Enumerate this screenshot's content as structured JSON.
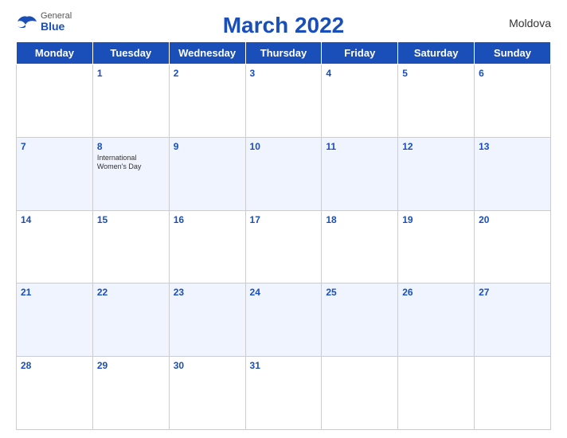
{
  "header": {
    "title": "March 2022",
    "country": "Moldova",
    "logo": {
      "general": "General",
      "blue": "Blue"
    }
  },
  "days_of_week": [
    "Monday",
    "Tuesday",
    "Wednesday",
    "Thursday",
    "Friday",
    "Saturday",
    "Sunday"
  ],
  "weeks": [
    [
      {
        "num": "",
        "event": ""
      },
      {
        "num": "1",
        "event": ""
      },
      {
        "num": "2",
        "event": ""
      },
      {
        "num": "3",
        "event": ""
      },
      {
        "num": "4",
        "event": ""
      },
      {
        "num": "5",
        "event": ""
      },
      {
        "num": "6",
        "event": ""
      }
    ],
    [
      {
        "num": "7",
        "event": ""
      },
      {
        "num": "8",
        "event": "International Women's Day"
      },
      {
        "num": "9",
        "event": ""
      },
      {
        "num": "10",
        "event": ""
      },
      {
        "num": "11",
        "event": ""
      },
      {
        "num": "12",
        "event": ""
      },
      {
        "num": "13",
        "event": ""
      }
    ],
    [
      {
        "num": "14",
        "event": ""
      },
      {
        "num": "15",
        "event": ""
      },
      {
        "num": "16",
        "event": ""
      },
      {
        "num": "17",
        "event": ""
      },
      {
        "num": "18",
        "event": ""
      },
      {
        "num": "19",
        "event": ""
      },
      {
        "num": "20",
        "event": ""
      }
    ],
    [
      {
        "num": "21",
        "event": ""
      },
      {
        "num": "22",
        "event": ""
      },
      {
        "num": "23",
        "event": ""
      },
      {
        "num": "24",
        "event": ""
      },
      {
        "num": "25",
        "event": ""
      },
      {
        "num": "26",
        "event": ""
      },
      {
        "num": "27",
        "event": ""
      }
    ],
    [
      {
        "num": "28",
        "event": ""
      },
      {
        "num": "29",
        "event": ""
      },
      {
        "num": "30",
        "event": ""
      },
      {
        "num": "31",
        "event": ""
      },
      {
        "num": "",
        "event": ""
      },
      {
        "num": "",
        "event": ""
      },
      {
        "num": "",
        "event": ""
      }
    ]
  ]
}
